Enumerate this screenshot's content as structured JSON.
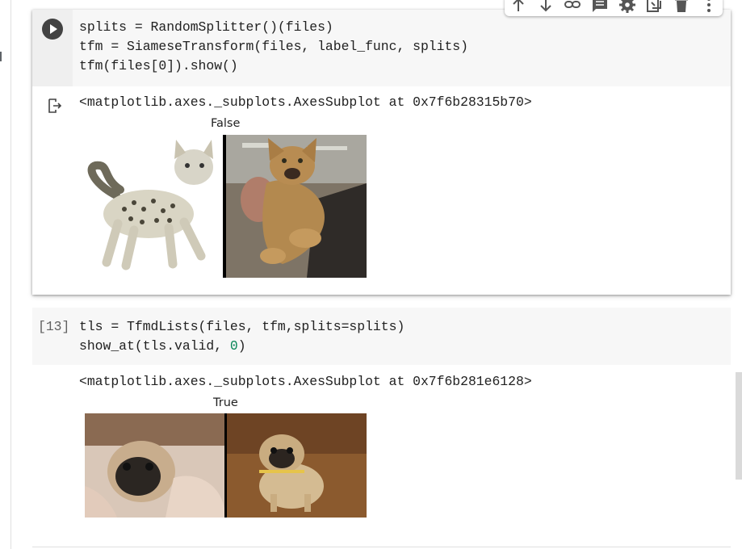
{
  "cell1": {
    "source_lines": [
      "splits = RandomSplitter()(files)",
      "tfm = SiameseTransform(files, label_func, splits)",
      "tfm(files[0]).show()"
    ],
    "output_text": "<matplotlib.axes._subplots.AxesSubplot at 0x7f6b28315b70>",
    "figure_title": "False",
    "left_image": "Spotted white Egyptian Mau cat",
    "right_image": "Abyssinian cat held in hand"
  },
  "cell2": {
    "execution_count": "[13]",
    "source_line1": "tls = TfmdLists(files, tfm,splits=splits)",
    "source_line2_prefix": "show_at(tls.valid, ",
    "source_line2_num": "0",
    "source_line2_suffix": ")",
    "output_text": "<matplotlib.axes._subplots.AxesSubplot at 0x7f6b281e6128>",
    "figure_title": "True",
    "left_image": "Pug lying on blanket",
    "right_image": "Pug standing on wood floor"
  },
  "toolbar": {
    "icons": [
      "arrow-up-icon",
      "arrow-down-icon",
      "link-icon",
      "comment-icon",
      "gear-icon",
      "mirror-cell-icon",
      "delete-icon",
      "more-vert-icon"
    ]
  },
  "colors": {
    "code_bg": "#f7f7f7",
    "number": "#098658",
    "run_button": "#424242"
  }
}
